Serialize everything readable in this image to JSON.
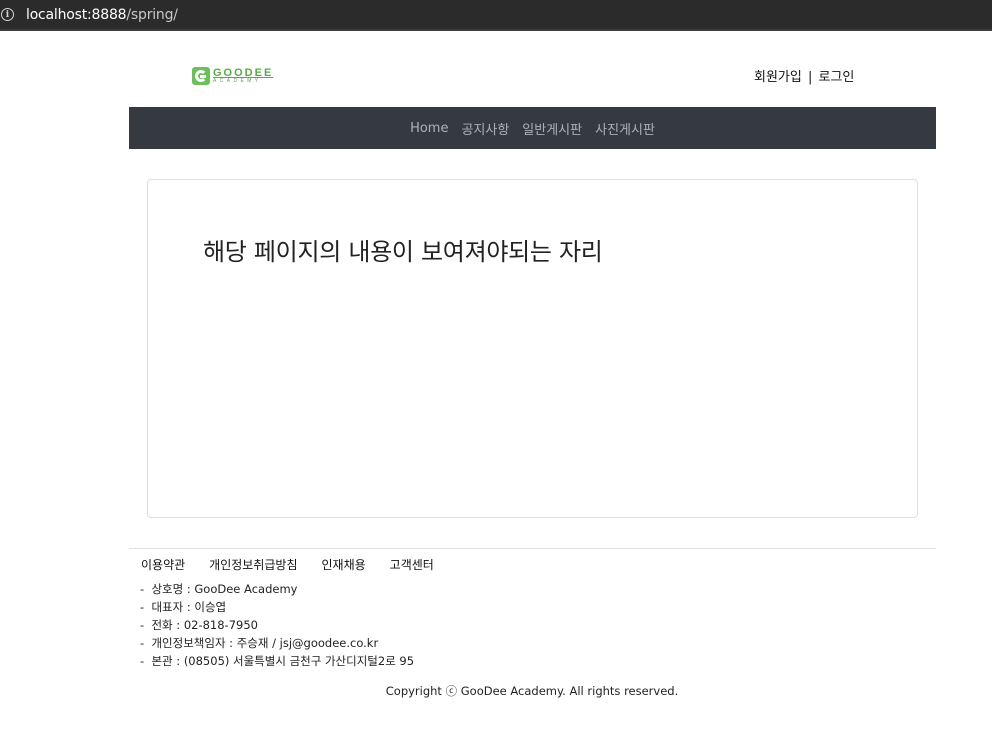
{
  "browser": {
    "url_host": "localhost:8888",
    "url_path": "/spring/",
    "info_icon": "info-icon"
  },
  "header": {
    "logo": {
      "name": "GOODEE",
      "sub": "ACADEMY",
      "color": "#5aa84a"
    },
    "signup_label": "회원가입",
    "separator": "|",
    "login_label": "로그인"
  },
  "nav": {
    "background": "#343a40",
    "items": [
      {
        "label": "Home"
      },
      {
        "label": "공지사항"
      },
      {
        "label": "일반게시판"
      },
      {
        "label": "사진게시판"
      }
    ]
  },
  "main": {
    "placeholder_text": "해당 페이지의 내용이 보여져야되는 자리"
  },
  "footer": {
    "links": [
      {
        "label": "이용약관"
      },
      {
        "label": "개인정보취급방침"
      },
      {
        "label": "인재채용"
      },
      {
        "label": "고객센터"
      }
    ],
    "info": [
      "상호명 : GooDee Academy",
      "대표자 : 이승엽",
      "전화 : 02-818-7950",
      "개인정보책임자 : 주승재 / jsj@goodee.co.kr",
      "본관 : (08505) 서울특별시 금천구 가산디지털2로 95"
    ],
    "copyright": "Copyright ⓒ GooDee Academy. All rights reserved."
  }
}
